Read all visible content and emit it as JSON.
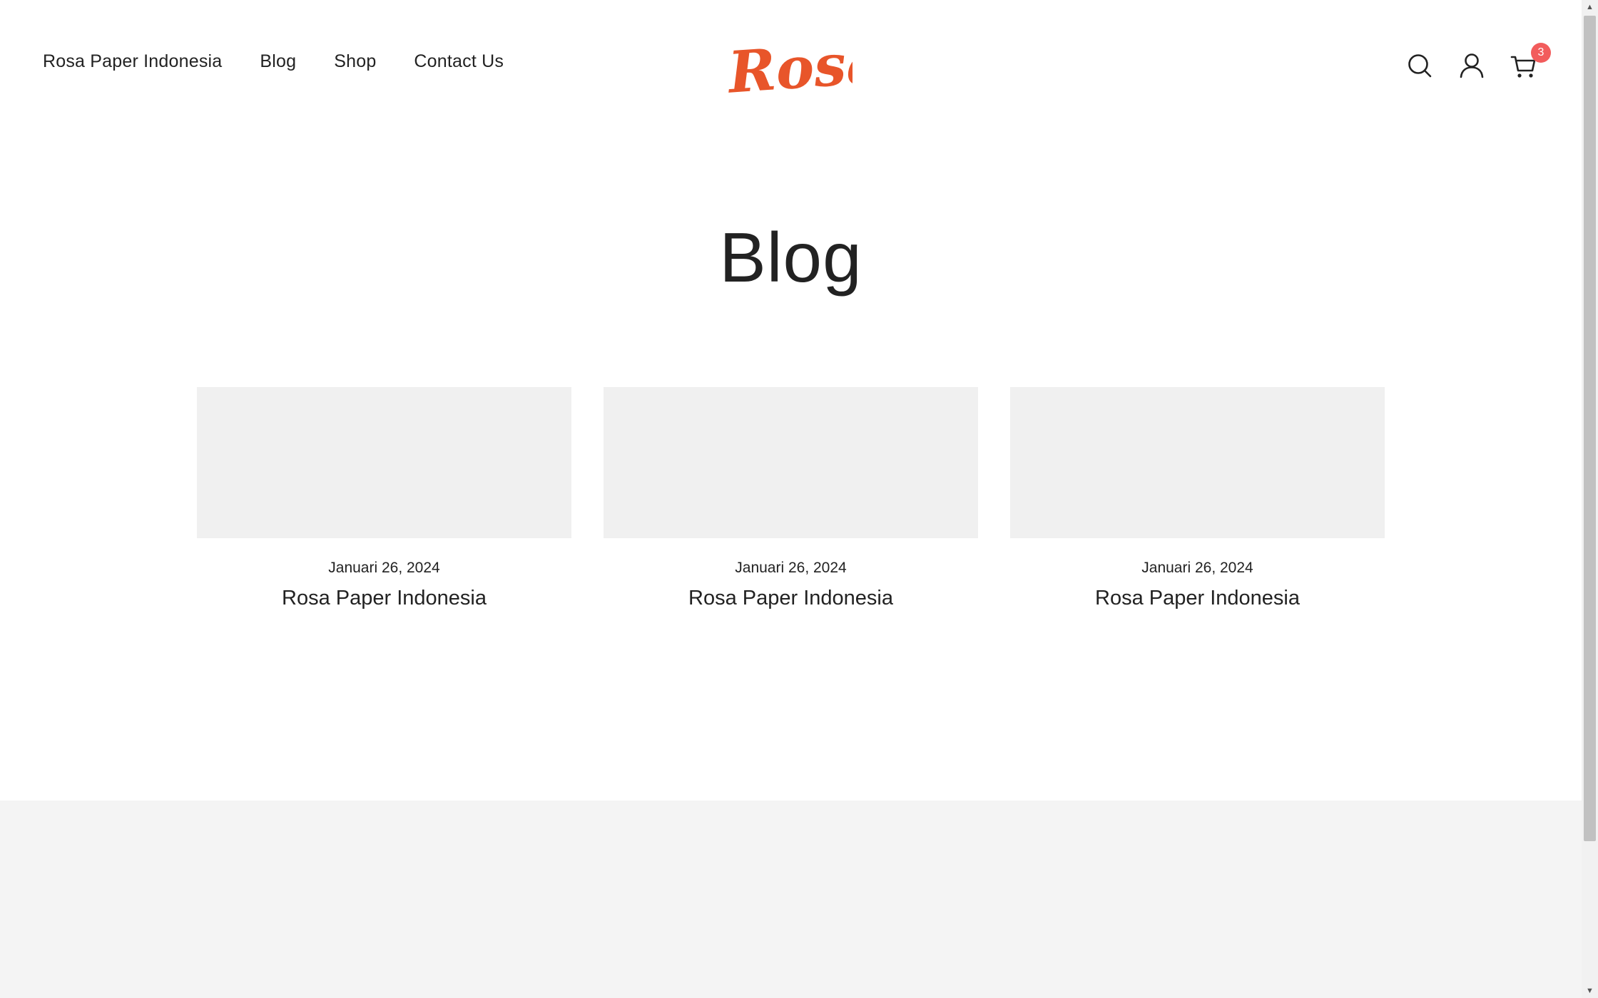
{
  "header": {
    "nav": [
      {
        "label": "Rosa Paper Indonesia"
      },
      {
        "label": "Blog"
      },
      {
        "label": "Shop"
      },
      {
        "label": "Contact Us"
      }
    ],
    "logo_text": "Rosa",
    "cart_count": "3",
    "icons": {
      "search": "search-icon",
      "account": "user-icon",
      "cart": "cart-icon"
    }
  },
  "page": {
    "title": "Blog"
  },
  "posts": [
    {
      "date": "Januari 26, 2024",
      "title": "Rosa Paper Indonesia"
    },
    {
      "date": "Januari 26, 2024",
      "title": "Rosa Paper Indonesia"
    },
    {
      "date": "Januari 26, 2024",
      "title": "Rosa Paper Indonesia"
    }
  ],
  "colors": {
    "brand": "#e8552a",
    "badge": "#f25c5c",
    "thumbnail": "#f0f0f0",
    "footer": "#f4f4f4"
  }
}
